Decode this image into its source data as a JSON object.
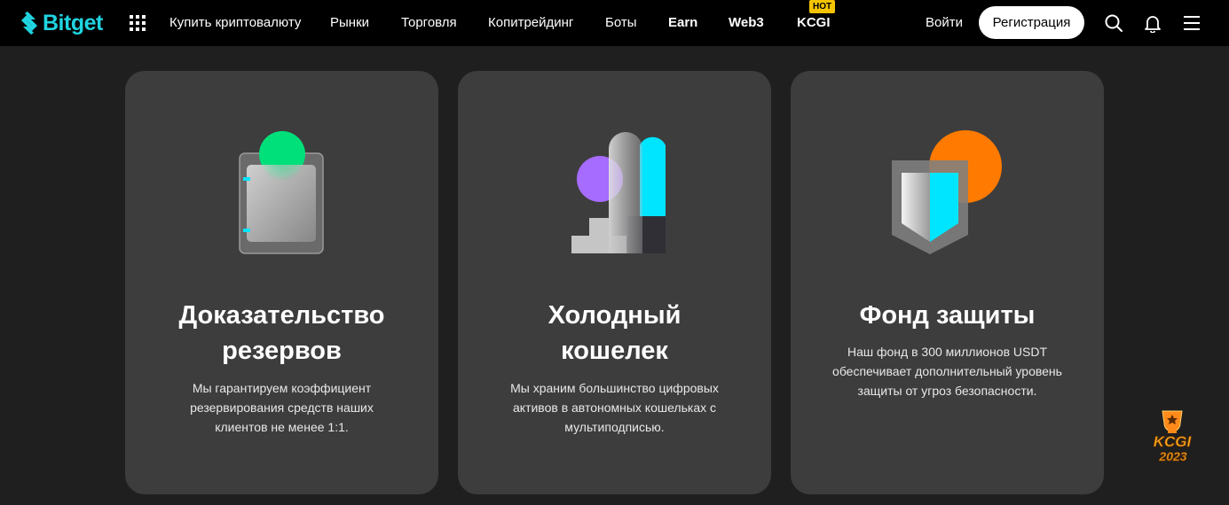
{
  "header": {
    "logo_text": "Bitget",
    "nav": [
      {
        "label": "Купить криптовалюту",
        "bold": false
      },
      {
        "label": "Рынки",
        "bold": false
      },
      {
        "label": "Торговля",
        "bold": false
      },
      {
        "label": "Копитрейдинг",
        "bold": false
      },
      {
        "label": "Боты",
        "bold": false
      },
      {
        "label": "Earn",
        "bold": true
      },
      {
        "label": "Web3",
        "bold": true
      },
      {
        "label": "KCGI",
        "bold": true
      }
    ],
    "hot_badge": "HOT",
    "login_label": "Войти",
    "register_label": "Регистрация",
    "icons": [
      "apps-grid-icon",
      "search-icon",
      "bell-icon",
      "menu-icon"
    ]
  },
  "cards": [
    {
      "title_line1": "Доказательство",
      "title_line2": "резервов",
      "desc_line1": "Мы гарантируем коэффициент",
      "desc_line2": "резервирования средств наших",
      "desc_line3": "клиентов не менее 1:1.",
      "accent_color": "#00e07a"
    },
    {
      "title_line1": "Холодный",
      "title_line2": "кошелек",
      "desc_line1": "Мы храним большинство цифровых",
      "desc_line2": "активов в автономных кошельках с",
      "desc_line3": "мультиподписью.",
      "accent_color": "#00e5ff"
    },
    {
      "title_line1": "Фонд защиты",
      "desc_line1": "Наш фонд в 300 миллионов USDT",
      "desc_line2": "обеспечивает дополнительный уровень",
      "desc_line3": "защиты от угроз безопасности.",
      "accent_color": "#ff7a00"
    }
  ],
  "floating_badge": {
    "line1": "KCGI",
    "line2": "2023"
  },
  "colors": {
    "brand": "#1fd4e0",
    "header_bg": "#000000",
    "page_bg": "#1f1f1f",
    "card_bg": "#3d3d3d",
    "hot_badge": "#f5c400"
  }
}
